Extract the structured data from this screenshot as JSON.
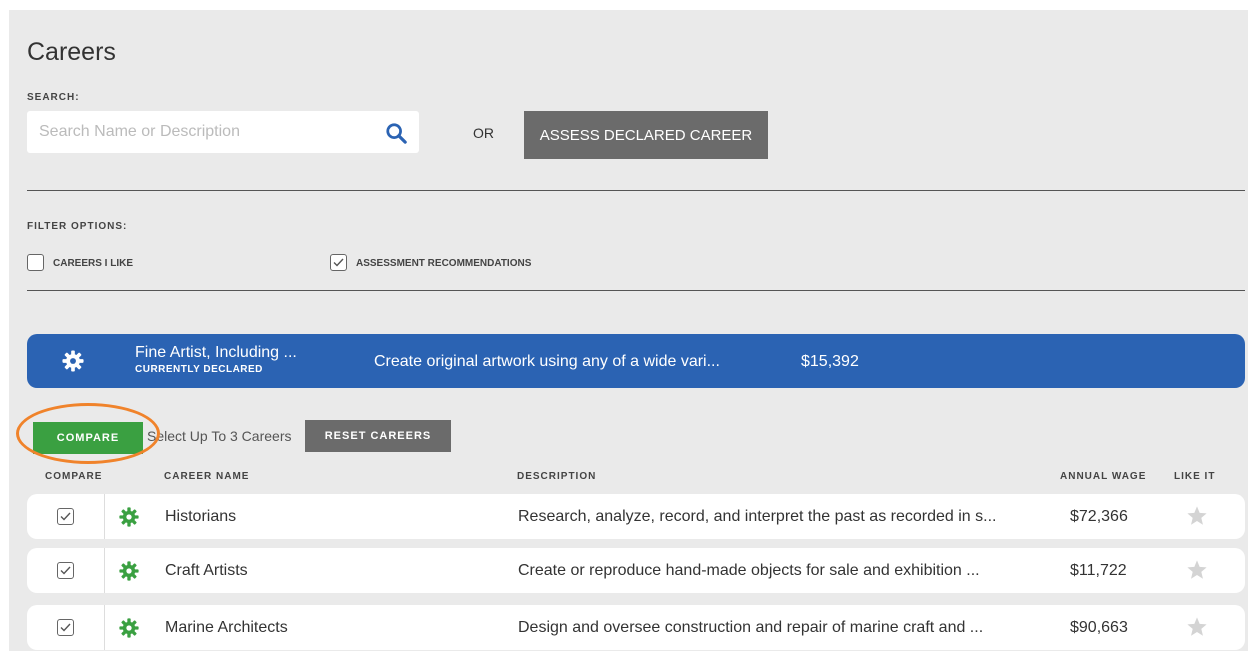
{
  "page": {
    "title": "Careers"
  },
  "search": {
    "label": "SEARCH:",
    "placeholder": "Search Name or Description",
    "or_text": "OR",
    "assess_button": "ASSESS DECLARED CAREER"
  },
  "filters": {
    "label": "FILTER OPTIONS:",
    "options": [
      {
        "label": "CAREERS I LIKE",
        "checked": false
      },
      {
        "label": "ASSESSMENT RECOMMENDATIONS",
        "checked": true
      }
    ]
  },
  "declared": {
    "name": "Fine Artist, Including ...",
    "tag": "CURRENTLY DECLARED",
    "description": "Create original artwork using any of a wide vari...",
    "wage": "$15,392",
    "icon": "gear-icon"
  },
  "compare_controls": {
    "compare_button": "COMPARE",
    "hint": "Select Up To 3 Careers",
    "reset_button": "RESET CAREERS"
  },
  "table": {
    "columns": [
      "COMPARE",
      "CAREER NAME",
      "DESCRIPTION",
      "ANNUAL WAGE",
      "LIKE IT"
    ],
    "rows": [
      {
        "name": "Historians",
        "description": "Research, analyze, record, and interpret the past as recorded in s...",
        "wage": "$72,366",
        "checked": true,
        "liked": false
      },
      {
        "name": "Craft Artists",
        "description": "Create or reproduce hand-made objects for sale and exhibition ...",
        "wage": "$11,722",
        "checked": true,
        "liked": false
      },
      {
        "name": "Marine Architects",
        "description": "Design and oversee construction and repair of marine craft and ...",
        "wage": "$90,663",
        "checked": true,
        "liked": false
      }
    ]
  },
  "colors": {
    "declared_bar": "#2b63b3",
    "compare_green": "#3aa041",
    "gear_green": "#3aa041",
    "highlight_ring": "#f0832b",
    "button_gray": "#6b6b6b"
  }
}
